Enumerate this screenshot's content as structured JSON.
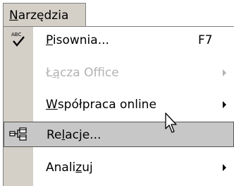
{
  "menu": {
    "title_underlined": "N",
    "title_rest": "arzędzia",
    "items": [
      {
        "before": "",
        "u": "P",
        "after": "isownia...",
        "shortcut": "F7",
        "icon": "spelling-check-icon",
        "disabled": false
      },
      {
        "before": "Ł",
        "u": "ą",
        "after": "cza Office",
        "icon": "",
        "disabled": true,
        "submenu_arrow": "chevron-right-icon"
      },
      {
        "before": "",
        "u": "W",
        "after": "spółpraca online",
        "icon": "",
        "disabled": false,
        "submenu_arrow": "chevron-right-icon"
      },
      {
        "before": "Re",
        "u": "l",
        "after": "acje...",
        "icon": "relationships-icon",
        "disabled": false,
        "highlighted": true
      },
      {
        "before": "Anali",
        "u": "z",
        "after": "uj",
        "icon": "",
        "disabled": false,
        "submenu_arrow": "chevron-right-icon"
      }
    ]
  },
  "colors": {
    "gutter": "#d4d0c8",
    "highlight": "#c7c7c7",
    "disabled_text": "#b3b3b3"
  }
}
